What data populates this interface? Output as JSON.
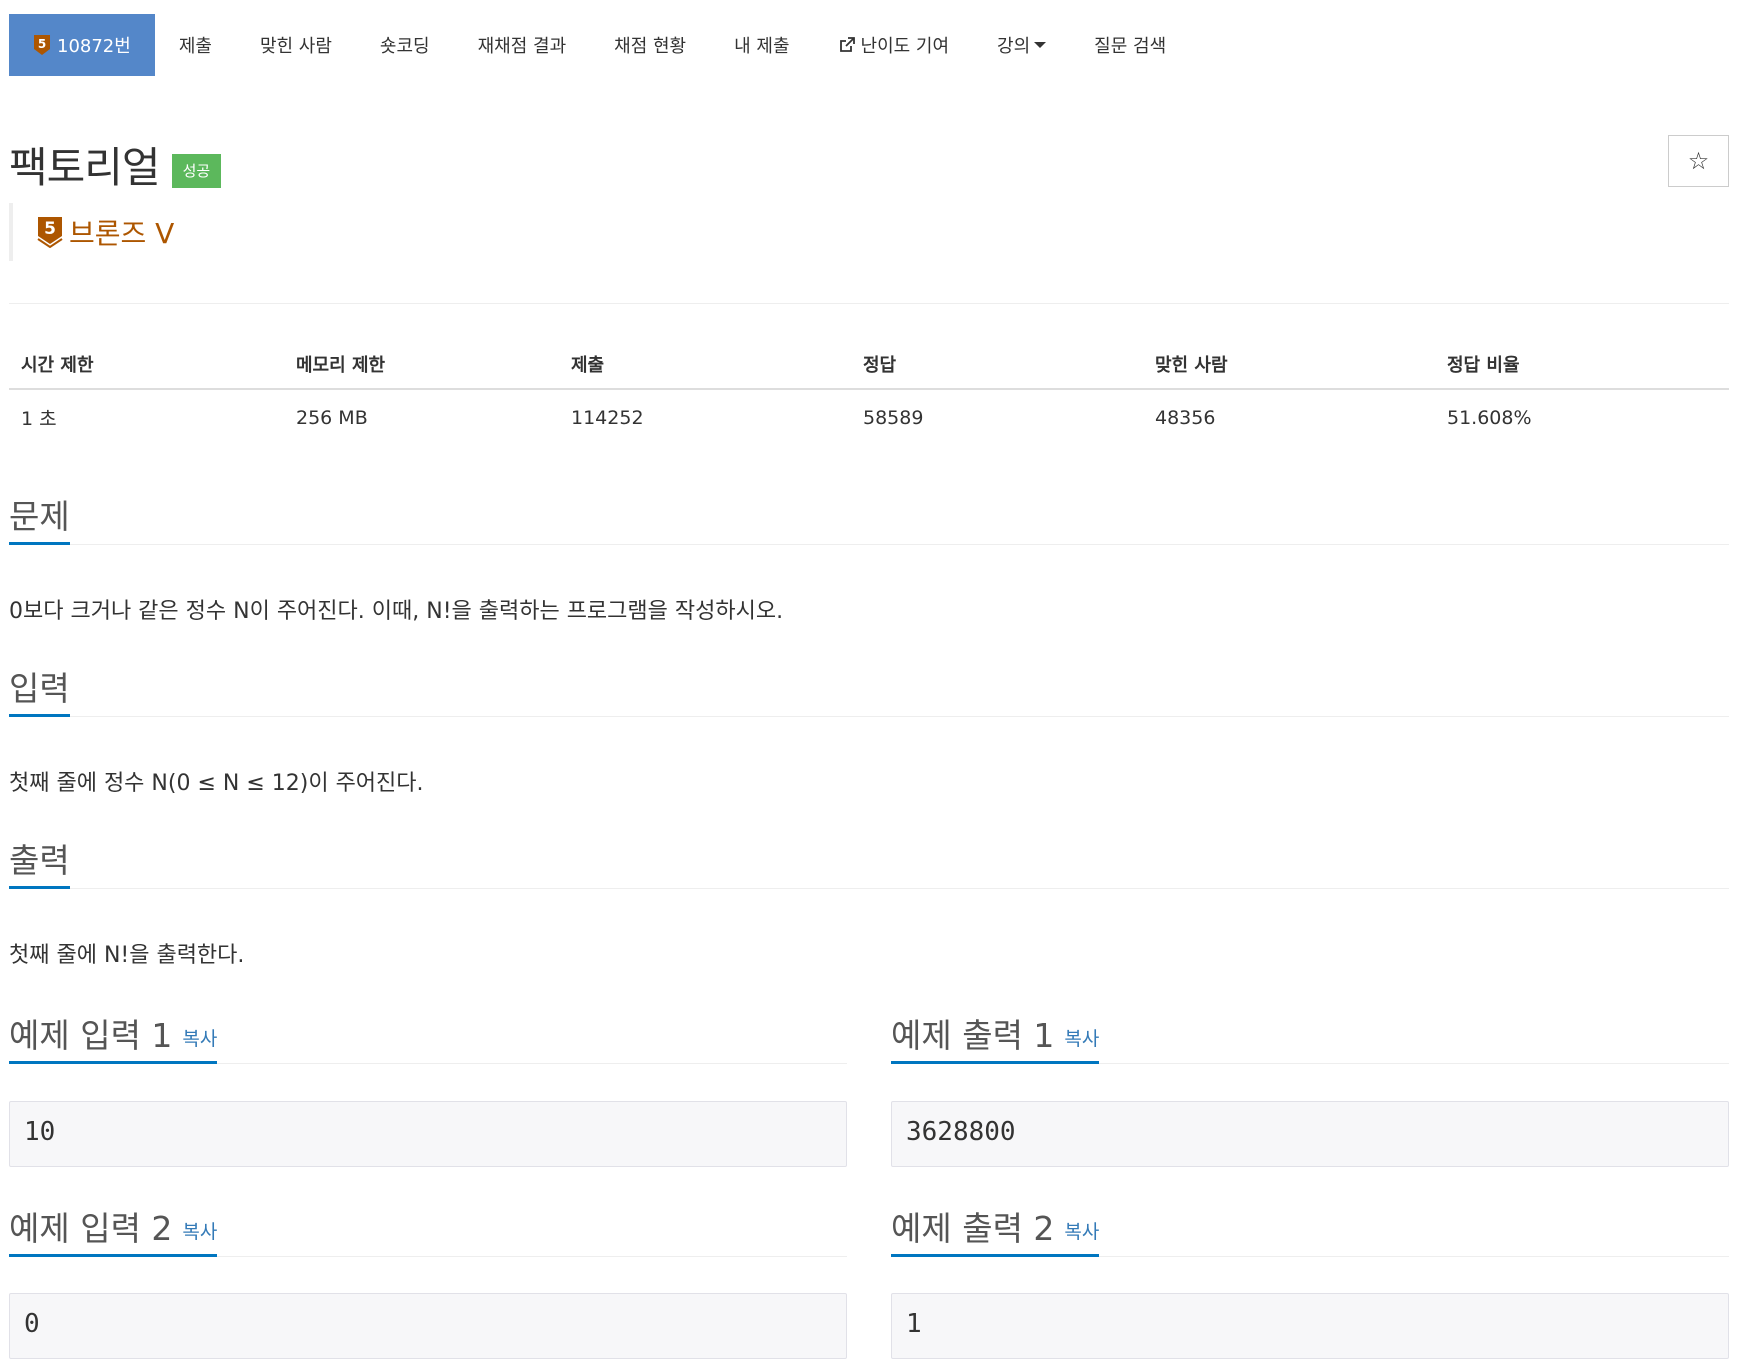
{
  "nav": {
    "problem_number": "10872번",
    "items": [
      "제출",
      "맞힌 사람",
      "숏코딩",
      "재채점 결과",
      "채점 현황",
      "내 제출",
      "난이도 기여",
      "강의",
      "질문 검색"
    ]
  },
  "problem": {
    "title": "팩토리얼",
    "status_badge": "성공",
    "tier_label": "브론즈 V",
    "tier_number": "5",
    "star_label": "☆"
  },
  "info": {
    "headers": [
      "시간 제한",
      "메모리 제한",
      "제출",
      "정답",
      "맞힌 사람",
      "정답 비율"
    ],
    "values": [
      "1 초",
      "256 MB",
      "114252",
      "58589",
      "48356",
      "51.608%"
    ]
  },
  "sections": {
    "description_title": "문제",
    "description": "0보다 크거나 같은 정수 N이 주어진다. 이때, N!을 출력하는 프로그램을 작성하시오.",
    "input_title": "입력",
    "input": "첫째 줄에 정수 N(0 ≤ N ≤ 12)이 주어진다.",
    "output_title": "출력",
    "output": "첫째 줄에 N!을 출력한다."
  },
  "samples": {
    "copy_label": "복사",
    "input1_title": "예제 입력 1",
    "output1_title": "예제 출력 1",
    "input2_title": "예제 입력 2",
    "output2_title": "예제 출력 2",
    "input1": "10",
    "output1": "3628800",
    "input2": "0",
    "output2": "1"
  },
  "colors": {
    "nav_active": "#5487c9",
    "badge_success": "#5cb85c",
    "tier_bronze": "#ad5600",
    "section_underline": "#0076c0",
    "link": "#337ab7"
  }
}
